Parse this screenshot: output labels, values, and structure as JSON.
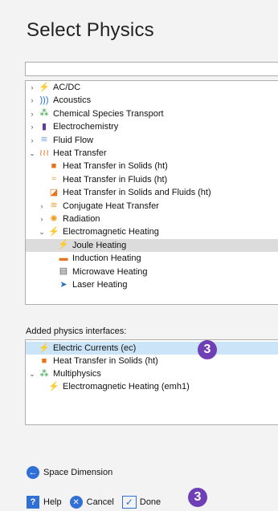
{
  "title": "Select Physics",
  "search": {
    "value": "",
    "placeholder": ""
  },
  "tree": [
    {
      "indent": 0,
      "arrow": "›",
      "icon": "ac-dc-icon",
      "glyph": "⚡",
      "color": "#1f6fd1",
      "label": "AC/DC"
    },
    {
      "indent": 0,
      "arrow": "›",
      "icon": "acoustics-icon",
      "glyph": ")))",
      "color": "#1f6fd1",
      "label": "Acoustics"
    },
    {
      "indent": 0,
      "arrow": "›",
      "icon": "chemical-species-transport-icon",
      "glyph": "⁂",
      "color": "#2a9d3c",
      "label": "Chemical Species Transport"
    },
    {
      "indent": 0,
      "arrow": "›",
      "icon": "electrochemistry-icon",
      "glyph": "▮",
      "color": "#5a3fa0",
      "label": "Electrochemistry"
    },
    {
      "indent": 0,
      "arrow": "›",
      "icon": "fluid-flow-icon",
      "glyph": "≋",
      "color": "#7aa8d8",
      "label": "Fluid Flow"
    },
    {
      "indent": 0,
      "arrow": "⌄",
      "icon": "heat-transfer-icon",
      "glyph": "≀≀≀",
      "color": "#e8731a",
      "label": "Heat Transfer"
    },
    {
      "indent": 1,
      "arrow": "",
      "icon": "heat-transfer-solids-icon",
      "glyph": "■",
      "color": "#e8731a",
      "label": "Heat Transfer in Solids (ht)"
    },
    {
      "indent": 1,
      "arrow": "",
      "icon": "heat-transfer-fluids-icon",
      "glyph": "≈",
      "color": "#f0a04a",
      "label": "Heat Transfer in Fluids (ht)"
    },
    {
      "indent": 1,
      "arrow": "",
      "icon": "heat-transfer-solids-fluids-icon",
      "glyph": "◪",
      "color": "#e8731a",
      "label": "Heat Transfer in Solids and Fluids (ht)"
    },
    {
      "indent": 1,
      "arrow": "›",
      "icon": "conjugate-heat-transfer-icon",
      "glyph": "≋",
      "color": "#e8a23a",
      "label": "Conjugate Heat Transfer"
    },
    {
      "indent": 1,
      "arrow": "›",
      "icon": "radiation-icon",
      "glyph": "✺",
      "color": "#f09a1a",
      "label": "Radiation"
    },
    {
      "indent": 1,
      "arrow": "⌄",
      "icon": "electromagnetic-heating-icon",
      "glyph": "⚡",
      "color": "#e8731a",
      "label": "Electromagnetic Heating"
    },
    {
      "indent": 2,
      "arrow": "",
      "icon": "joule-heating-icon",
      "glyph": "⚡",
      "color": "#1f6fd1",
      "label": "Joule Heating",
      "selected": true
    },
    {
      "indent": 2,
      "arrow": "",
      "icon": "induction-heating-icon",
      "glyph": "▬",
      "color": "#e8731a",
      "label": "Induction Heating"
    },
    {
      "indent": 2,
      "arrow": "",
      "icon": "microwave-heating-icon",
      "glyph": "▤",
      "color": "#555555",
      "label": "Microwave Heating"
    },
    {
      "indent": 2,
      "arrow": "",
      "icon": "laser-heating-icon",
      "glyph": "➤",
      "color": "#1f6fd1",
      "label": "Laser Heating"
    }
  ],
  "added_label": "Added physics interfaces:",
  "added": [
    {
      "indent": 0,
      "arrow": "",
      "icon": "electric-currents-icon",
      "glyph": "⚡",
      "color": "#1f6fd1",
      "label": "Electric Currents (ec)",
      "selected": true
    },
    {
      "indent": 0,
      "arrow": "",
      "icon": "heat-transfer-solids-icon",
      "glyph": "■",
      "color": "#e8731a",
      "label": "Heat Transfer in Solids (ht)"
    },
    {
      "indent": 0,
      "arrow": "⌄",
      "icon": "multiphysics-icon",
      "glyph": "⁂",
      "color": "#2a9d3c",
      "label": "Multiphysics"
    },
    {
      "indent": 1,
      "arrow": "",
      "icon": "electromagnetic-heating-emh-icon",
      "glyph": "⚡",
      "color": "#c0303a",
      "label": "Electromagnetic Heating (emh1)"
    }
  ],
  "badges": {
    "top": "3",
    "bottom": "3",
    "color": "#6f3fb6"
  },
  "space_dimension": "Space Dimension",
  "buttons": {
    "help": "Help",
    "cancel": "Cancel",
    "done": "Done"
  }
}
